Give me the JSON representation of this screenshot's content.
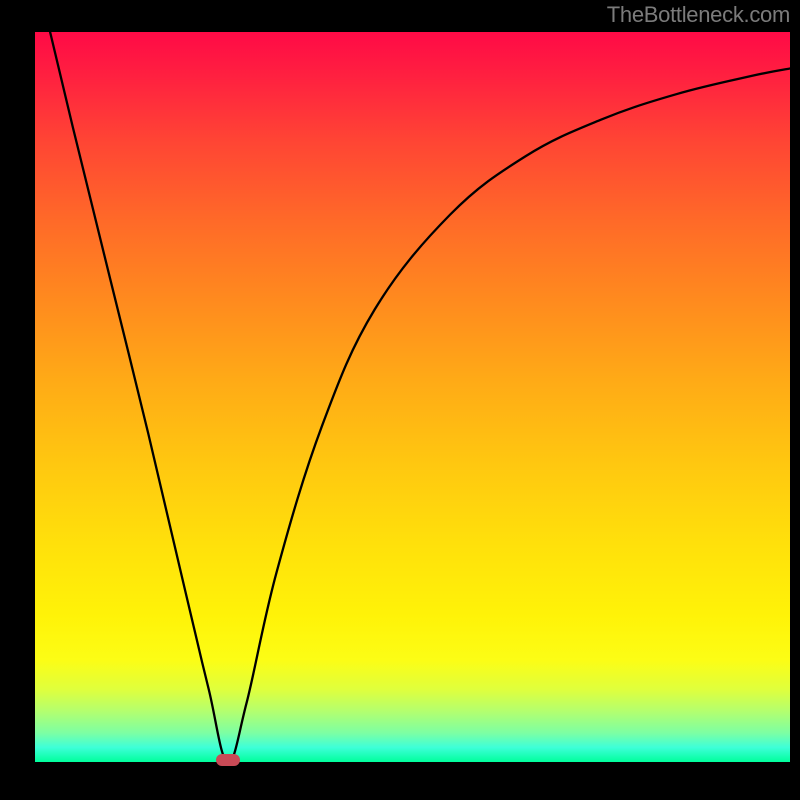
{
  "watermark": "TheBottleneck.com",
  "chart_data": {
    "type": "line",
    "title": "",
    "xlabel": "",
    "ylabel": "",
    "xlim": [
      0,
      100
    ],
    "ylim": [
      0,
      100
    ],
    "background_gradient": {
      "top": "#ff0a46",
      "bottom": "#00ff9c",
      "description": "vertical red-to-green gradient indicating bottleneck severity"
    },
    "minimum_point": {
      "x": 25.5,
      "y": 0
    },
    "series": [
      {
        "name": "bottleneck-curve",
        "color": "#000000",
        "x": [
          2,
          5,
          10,
          15,
          20,
          23,
          25.5,
          28,
          32,
          38,
          45,
          55,
          65,
          75,
          85,
          95,
          100
        ],
        "y": [
          100,
          87,
          66,
          45,
          23,
          10,
          0,
          8,
          26,
          46,
          62,
          75,
          83,
          88,
          91.5,
          94,
          95
        ]
      }
    ],
    "annotations": {
      "minimum_marker": {
        "x": 25.5,
        "y": 0,
        "color": "#c94a56",
        "shape": "pill"
      }
    }
  }
}
